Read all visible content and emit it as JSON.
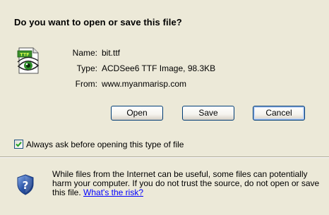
{
  "dialog": {
    "question": "Do you want to open or save this file?",
    "file": {
      "icon": "ttf-file-icon",
      "name_label": "Name:",
      "name_value": "bit.ttf",
      "type_label": "Type:",
      "type_value": "ACDSee6 TTF Image, 98.3KB",
      "from_label": "From:",
      "from_value": "www.myanmarisp.com"
    },
    "buttons": {
      "open_label": "Open",
      "save_label": "Save",
      "cancel_label": "Cancel"
    },
    "always_ask": {
      "label": "Always ask before opening this type of file",
      "checked": true
    },
    "warning": {
      "icon": "security-shield-icon",
      "text": "While files from the Internet can be useful, some files can potentially harm your computer. If you do not trust the source, do not open or save this file. ",
      "link_text": "What's the risk?"
    }
  },
  "colors": {
    "background": "#ece9d8",
    "button_border": "#003c74",
    "link": "#0000ff",
    "check_green": "#21a121",
    "shield_blue": "#2b55a8"
  }
}
